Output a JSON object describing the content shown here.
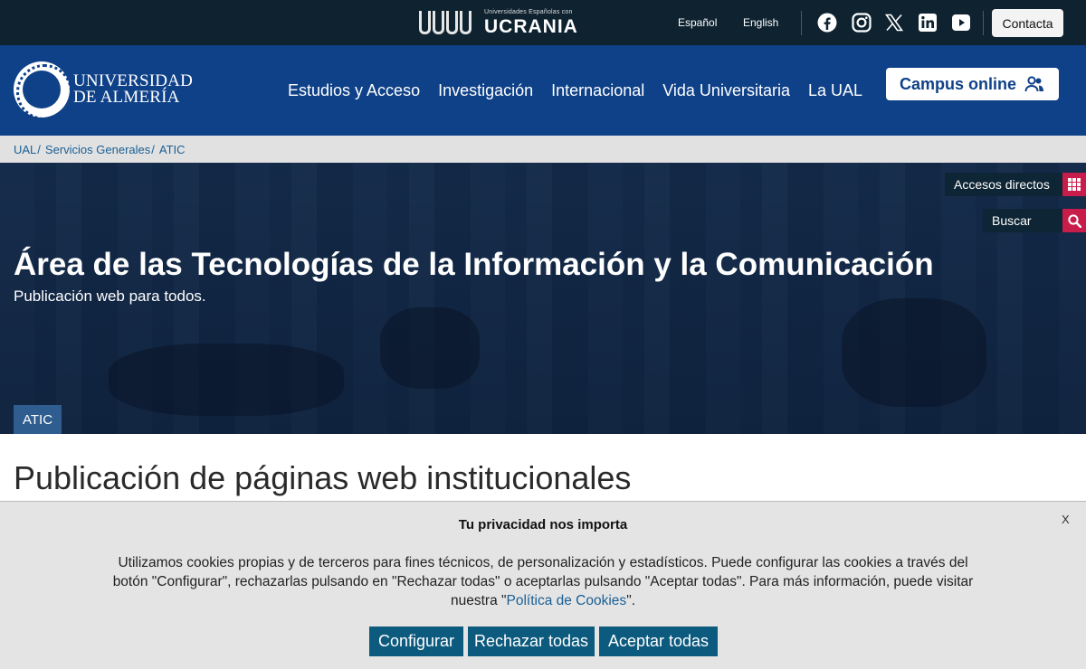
{
  "topbar": {
    "ukraine_small": "Universidades Españolas con",
    "ukraine_big": "UCRANIA",
    "languages": [
      "Español",
      "English"
    ],
    "social_icons": [
      "facebook-icon",
      "instagram-icon",
      "x-icon",
      "linkedin-icon",
      "youtube-icon"
    ],
    "contact_label": "Contacta"
  },
  "header": {
    "university_line1": "UNIVERSIDAD",
    "university_line2": "DE ALMERÍA",
    "nav": [
      "Estudios y Acceso",
      "Investigación",
      "Internacional",
      "Vida Universitaria",
      "La UAL"
    ],
    "campus_label": "Campus online"
  },
  "breadcrumb": [
    "UAL",
    "Servicios Generales",
    "ATIC"
  ],
  "hero": {
    "title": "Área de las Tecnologías de la Información y la Comunicación",
    "subtitle": "Publicación web para todos.",
    "quick_access_label": "Accesos directos",
    "search_label": "Buscar",
    "tag": "ATIC"
  },
  "page": {
    "title": "Publicación de páginas web institucionales"
  },
  "cookie": {
    "title": "Tu privacidad nos importa",
    "close": "X",
    "text_before": "Utilizamos cookies propias y de terceros para fines técnicos, de personalización y estadísticos. Puede configurar las cookies a través del botón \"Configurar\", rechazarlas pulsando en \"Rechazar todas\" o aceptarlas pulsando \"Aceptar todas\". Para más información, puede visitar nuestra \"",
    "link": "Política de Cookies",
    "text_after": "\".",
    "buttons": [
      "Configurar",
      "Rechazar todas",
      "Aceptar todas"
    ]
  },
  "colors": {
    "topbar": "#0e2230",
    "header": "#0f4188",
    "accent_red": "#c81d4a",
    "cookie_button": "#0c5a7e"
  }
}
